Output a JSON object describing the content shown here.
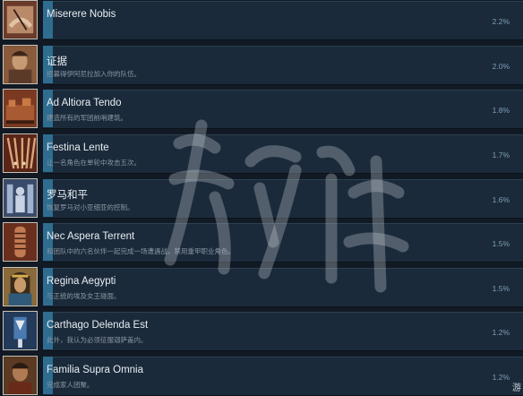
{
  "achievements": [
    {
      "title": "Miserere Nobis",
      "description": "",
      "percent": "2.2%",
      "icon": "hands-portrait-icon"
    },
    {
      "title": "证据",
      "description": "招募得伊阿尼拉加入你的队伍。",
      "percent": "2.0%",
      "icon": "woman-portrait-icon"
    },
    {
      "title": "Ad Altiora Tendo",
      "description": "建造所有的军团前哨建筑。",
      "percent": "1.8%",
      "icon": "town-icon"
    },
    {
      "title": "Festina Lente",
      "description": "让一名角色在单轮中攻击五次。",
      "percent": "1.7%",
      "icon": "spears-icon"
    },
    {
      "title": "罗马和平",
      "description": "恢复罗马对小亚细亚的控制。",
      "percent": "1.6%",
      "icon": "statue-icon"
    },
    {
      "title": "Nec Aspera Terrent",
      "description": "和团队中的六名伙伴一起完成一场遭遇战，禁用重甲职业角色。",
      "percent": "1.5%",
      "icon": "arm-icon"
    },
    {
      "title": "Regina Aegypti",
      "description": "与正统的埃及女王碰面。",
      "percent": "1.5%",
      "icon": "queen-portrait-icon"
    },
    {
      "title": "Carthago Delenda Est",
      "description": "此外，我认为必须征服迦萨盖内。",
      "percent": "1.2%",
      "icon": "banner-icon"
    },
    {
      "title": "Familia Supra Omnia",
      "description": "完成家人团聚。",
      "percent": "1.2%",
      "icon": "man-portrait-icon"
    }
  ],
  "corner_text": "游"
}
